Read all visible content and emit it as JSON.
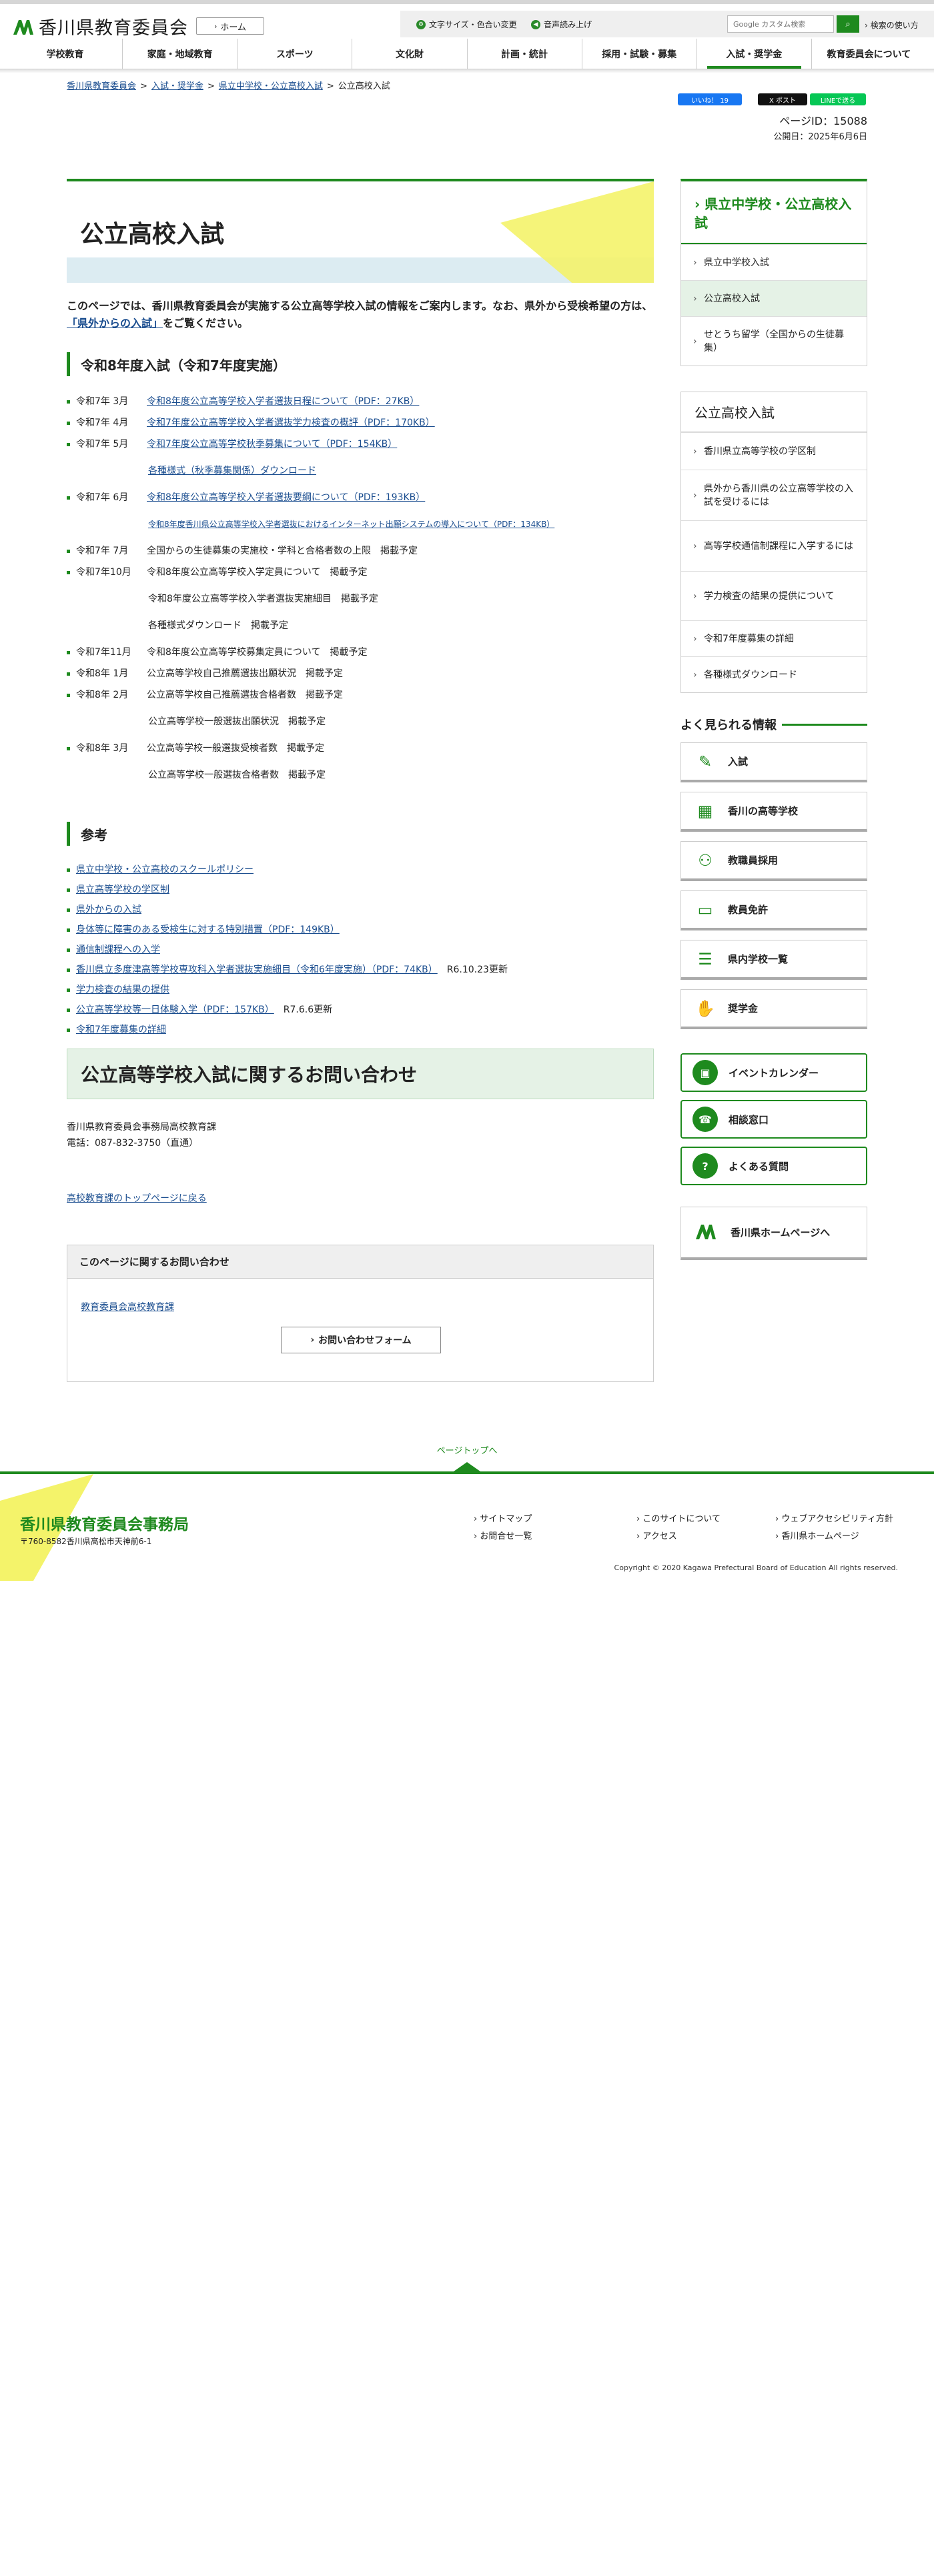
{
  "header": {
    "site_title": "香川県教育委員会",
    "home_label": "ホーム",
    "font_settings": "文字サイズ・色合い変更",
    "read_aloud": "音声読み上げ",
    "search_placeholder": "Google カスタム検索",
    "search_help": "検索の使い方"
  },
  "nav": [
    "学校教育",
    "家庭・地域教育",
    "スポーツ",
    "文化財",
    "計画・統計",
    "採用・試験・募集",
    "入試・奨学金",
    "教育委員会について"
  ],
  "breadcrumb": [
    "香川県教育委員会",
    "入試・奨学金",
    "県立中学校・公立高校入試",
    "公立高校入試"
  ],
  "social": {
    "like": "いいね！ 19",
    "post": "X ポスト",
    "line": "LINEで送る"
  },
  "page_id": "ページID：15088",
  "published": "公開日：2025年6月6日",
  "main": {
    "title": "公立高校入試",
    "intro_1": "このページでは、香川県教育委員会が実施する公立高等学校入試の情報をご案内します。なお、県外から受検希望の方は、",
    "intro_link": "「県外からの入試」",
    "intro_2": "をご覧ください。",
    "heading_r8": "令和8年度入試（令和7年度実施）",
    "schedule": [
      {
        "date": "令和7年 3月",
        "text": "令和8年度公立高等学校入学者選抜日程について（PDF：27KB）",
        "link": true
      },
      {
        "date": "令和7年 4月",
        "text": "令和7年度公立高等学校入学者選抜学力検査の概評（PDF：170KB）",
        "link": true
      },
      {
        "date": "令和7年 5月",
        "text": "令和7年度公立高等学校秋季募集について（PDF：154KB）",
        "link": true
      },
      {
        "sub": true,
        "text": "各種様式（秋季募集関係）ダウンロード",
        "link": true
      },
      {
        "date": "令和7年 6月",
        "text": "令和8年度公立高等学校入学者選抜要綱について（PDF：193KB）",
        "link": true
      },
      {
        "sub": true,
        "text": "令和8年度香川県公立高等学校入学者選抜におけるインターネット出願システムの導入について（PDF：134KB）",
        "link": true,
        "small": true
      },
      {
        "date": "令和7年 7月",
        "text": "全国からの生徒募集の実施校・学科と合格者数の上限　掲載予定",
        "link": false
      },
      {
        "date": "令和7年10月",
        "text": "令和8年度公立高等学校入学定員について　掲載予定",
        "link": false
      },
      {
        "sub": true,
        "text": "令和8年度公立高等学校入学者選抜実施細目　掲載予定",
        "link": false
      },
      {
        "sub": true,
        "text": "各種様式ダウンロード　掲載予定",
        "link": false
      },
      {
        "date": "令和7年11月",
        "text": "令和8年度公立高等学校募集定員について　掲載予定",
        "link": false
      },
      {
        "date": "令和8年 1月",
        "text": "公立高等学校自己推薦選抜出願状況　掲載予定",
        "link": false
      },
      {
        "date": "令和8年 2月",
        "text": "公立高等学校自己推薦選抜合格者数　掲載予定",
        "link": false
      },
      {
        "sub": true,
        "text": "公立高等学校一般選抜出願状況　掲載予定",
        "link": false
      },
      {
        "date": "令和8年 3月",
        "text": "公立高等学校一般選抜受検者数　掲載予定",
        "link": false
      },
      {
        "sub": true,
        "text": "公立高等学校一般選抜合格者数　掲載予定",
        "link": false
      }
    ],
    "heading_ref": "参考",
    "refs": [
      {
        "text": "県立中学校・公立高校のスクールポリシー",
        "note": ""
      },
      {
        "text": "県立高等学校の学区制",
        "note": ""
      },
      {
        "text": "県外からの入試",
        "note": ""
      },
      {
        "text": "身体等に障害のある受検生に対する特別措置（PDF：149KB）",
        "note": ""
      },
      {
        "text": "通信制課程への入学",
        "note": ""
      },
      {
        "text": "香川県立多度津高等学校専攻科入学者選抜実施細目（令和6年度実施）（PDF：74KB）",
        "note": "R6.10.23更新"
      },
      {
        "text": "学力検査の結果の提供",
        "note": ""
      },
      {
        "text": "公立高等学校等一日体験入学（PDF：157KB）",
        "note": "R7.6.6更新"
      },
      {
        "text": "令和7年度募集の詳細",
        "note": ""
      }
    ],
    "contact_heading": "公立高等学校入試に関するお問い合わせ",
    "contact_org": "香川県教育委員会事務局高校教育課",
    "contact_tel": "電話：087-832-3750（直通）",
    "back_link": "高校教育課のトップページに戻る",
    "inquiry_head": "このページに関するお問い合わせ",
    "inquiry_link": "教育委員会高校教育課",
    "inquiry_button": "お問い合わせフォーム"
  },
  "sidebar": {
    "section_title": "県立中学校・公立高校入試",
    "section_items": [
      "県立中学校入試",
      "公立高校入試",
      "せとうち留学（全国からの生徒募集）"
    ],
    "sub_title": "公立高校入試",
    "sub_items": [
      "香川県立高等学校の学区制",
      "県外から香川県の公立高等学校の入試を受けるには",
      "高等学校通信制課程に入学するには",
      "学力検査の結果の提供について",
      "令和7年度募集の詳細",
      "各種様式ダウンロード"
    ],
    "popular_title": "よく見られる情報",
    "popular": [
      {
        "label": "入試",
        "icon": "notebook-icon"
      },
      {
        "label": "香川の高等学校",
        "icon": "school-icon"
      },
      {
        "label": "教職員採用",
        "icon": "people-icon"
      },
      {
        "label": "教員免許",
        "icon": "id-card-icon"
      },
      {
        "label": "県内学校一覧",
        "icon": "list-icon"
      },
      {
        "label": "奨学金",
        "icon": "money-hand-icon"
      }
    ],
    "big_buttons": [
      {
        "label": "イベントカレンダー",
        "icon": "calendar-icon"
      },
      {
        "label": "相談窓口",
        "icon": "consult-icon"
      },
      {
        "label": "よくある質問",
        "icon": "faq-icon"
      }
    ],
    "kagawa_button": "香川県ホームページへ"
  },
  "footer": {
    "page_top": "ページトップへ",
    "org_name": "香川県教育委員会事務局",
    "address": "〒760-8582香川県高松市天神前6-1",
    "links": [
      "サイトマップ",
      "このサイトについて",
      "ウェブアクセシビリティ方針",
      "お問合せ一覧",
      "アクセス",
      "香川県ホームページ"
    ],
    "copyright": "Copyright © 2020 Kagawa Prefectural Board of Education All rights reserved."
  },
  "colors": {
    "accent": "#1e8a1e",
    "link": "#1a4d8f",
    "yellow": "#f4f36a",
    "title_stripe": "#dcecf2"
  }
}
